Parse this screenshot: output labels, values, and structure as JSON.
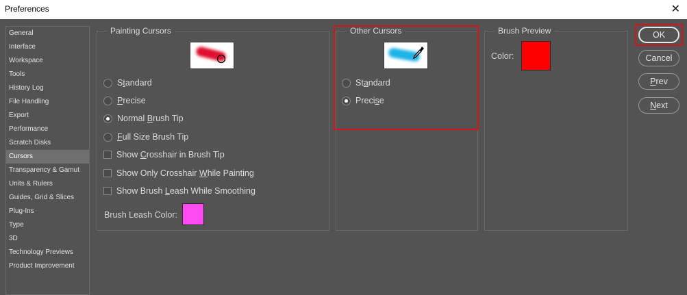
{
  "window": {
    "title": "Preferences",
    "close_glyph": "✕"
  },
  "sidebar": {
    "items": [
      "General",
      "Interface",
      "Workspace",
      "Tools",
      "History Log",
      "File Handling",
      "Export",
      "Performance",
      "Scratch Disks",
      "Cursors",
      "Transparency & Gamut",
      "Units & Rulers",
      "Guides, Grid & Slices",
      "Plug-Ins",
      "Type",
      "3D",
      "Technology Previews",
      "Product Improvement"
    ],
    "selected": "Cursors"
  },
  "painting_cursors": {
    "legend": "Painting Cursors",
    "preview_icon": "brush-stroke-preview",
    "stroke_color": "#e0102e",
    "options": {
      "standard": {
        "pre": "S",
        "u": "t",
        "post": "andard"
      },
      "precise": {
        "pre": "",
        "u": "P",
        "post": "recise"
      },
      "normal": {
        "pre": "Normal ",
        "u": "B",
        "post": "rush Tip"
      },
      "full": {
        "pre": "",
        "u": "F",
        "post": "ull Size Brush Tip"
      }
    },
    "selected_option": "Normal Brush Tip",
    "checkboxes": {
      "crosshair": {
        "pre": "Show ",
        "u": "C",
        "post": "rosshair in Brush Tip"
      },
      "only_crosshair": {
        "pre": "Show Only Crosshair ",
        "u": "W",
        "post": "hile Painting"
      },
      "leash": {
        "pre": "Show Brush ",
        "u": "L",
        "post": "eash While Smoothing"
      }
    },
    "leash_color_label": "Brush Leash Color:",
    "leash_color": "#ff4cf0"
  },
  "other_cursors": {
    "legend": "Other Cursors",
    "preview_icon": "eyedropper-stroke-preview",
    "stroke_color": "#1eb4e6",
    "options": {
      "standard": {
        "pre": "St",
        "u": "a",
        "post": "ndard"
      },
      "precise": {
        "pre": "Preci",
        "u": "s",
        "post": "e"
      }
    },
    "selected_option": "Precise"
  },
  "brush_preview": {
    "legend": "Brush Preview",
    "color_label": "Color:",
    "color": "#ff0000"
  },
  "buttons": {
    "ok": {
      "pre": "OK",
      "u": "",
      "post": ""
    },
    "cancel": {
      "pre": "Cancel",
      "u": "",
      "post": ""
    },
    "prev": {
      "pre": "",
      "u": "P",
      "post": "rev"
    },
    "next": {
      "pre": "",
      "u": "N",
      "post": "ext"
    }
  },
  "highlight_color": "#d8141b"
}
